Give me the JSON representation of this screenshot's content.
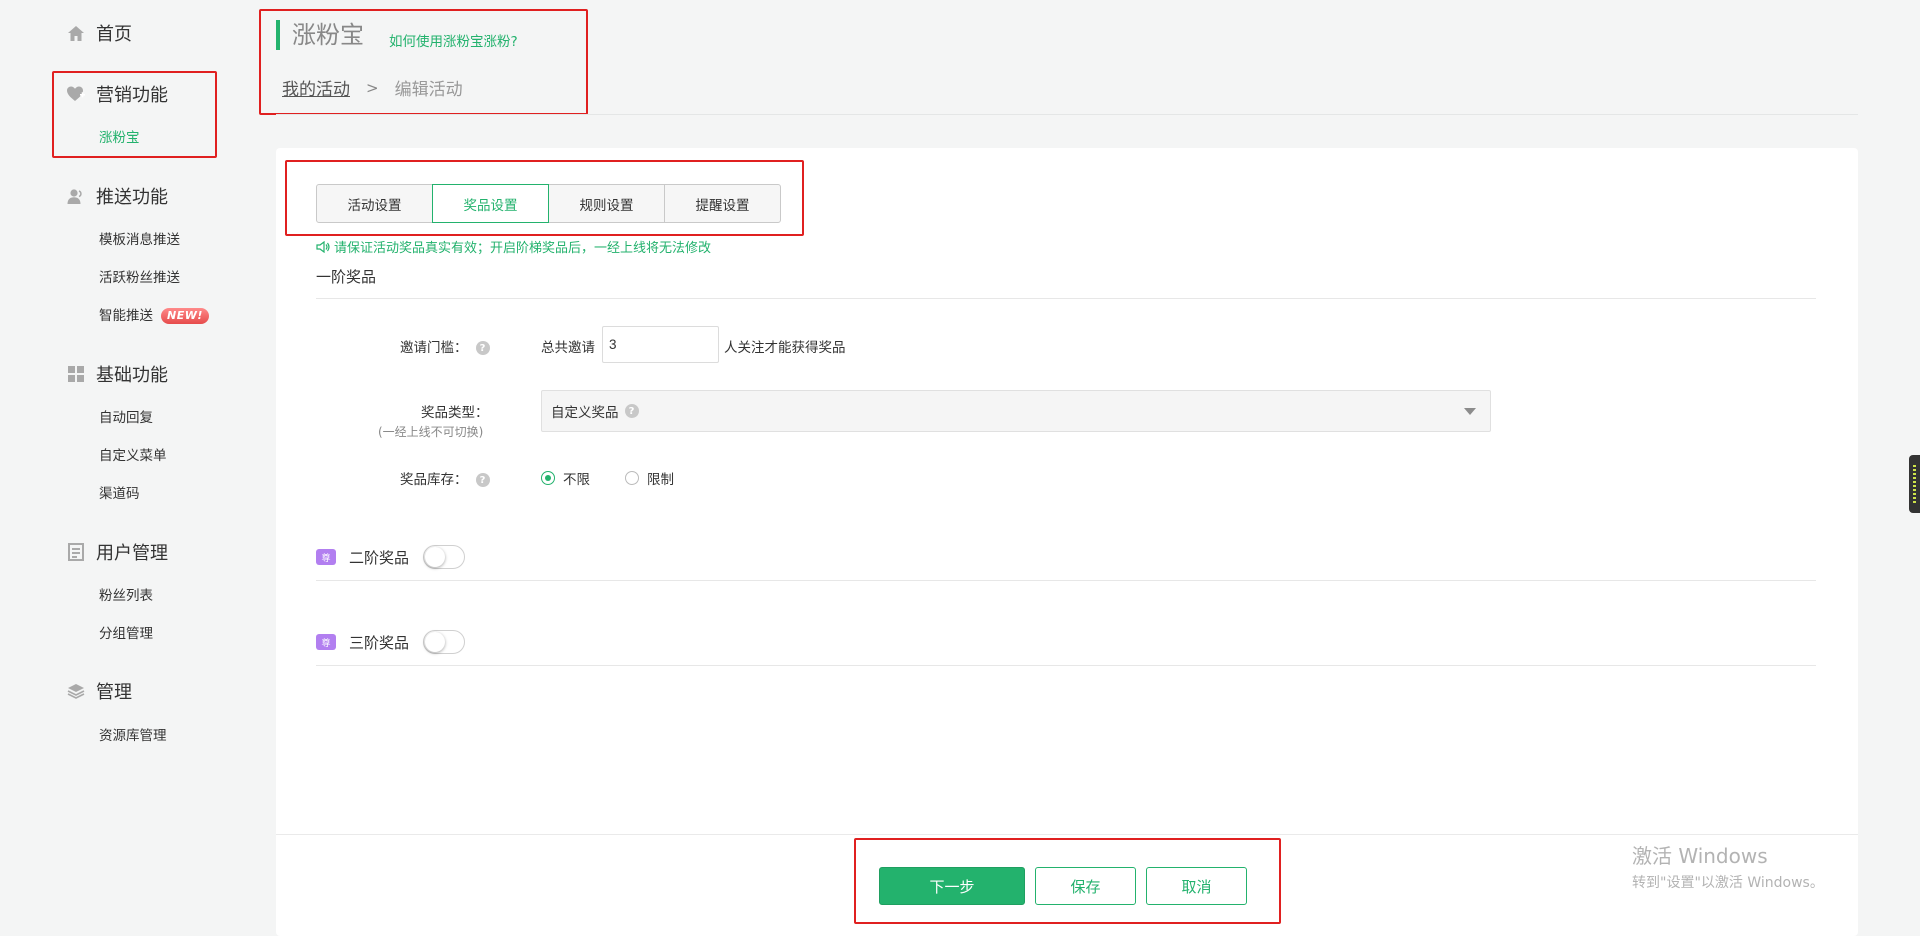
{
  "sidebar": {
    "home": "首页",
    "marketing": {
      "title": "营销功能",
      "items": [
        "涨粉宝"
      ]
    },
    "push": {
      "title": "推送功能",
      "items": [
        "模板消息推送",
        "活跃粉丝推送",
        "智能推送"
      ],
      "new_badge": "NEW!"
    },
    "basic": {
      "title": "基础功能",
      "items": [
        "自动回复",
        "自定义菜单",
        "渠道码"
      ]
    },
    "users": {
      "title": "用户管理",
      "items": [
        "粉丝列表",
        "分组管理"
      ]
    },
    "manage": {
      "title": "管理",
      "items": [
        "资源库管理"
      ]
    }
  },
  "header": {
    "title": "涨粉宝",
    "help_link": "如何使用涨粉宝涨粉?",
    "breadcrumb": {
      "parent": "我的活动",
      "separator": ">",
      "current": "编辑活动"
    }
  },
  "tabs": [
    "活动设置",
    "奖品设置",
    "规则设置",
    "提醒设置"
  ],
  "active_tab": "奖品设置",
  "notice": "请保证活动奖品真实有效；开启阶梯奖品后，一经上线将无法修改",
  "tier1": {
    "title": "一阶奖品",
    "invite": {
      "label": "邀请门槛：",
      "prefix": "总共邀请",
      "value": "3",
      "suffix": "人关注才能获得奖品"
    },
    "type": {
      "label": "奖品类型：",
      "note": "(一经上线不可切换)",
      "selected": "自定义奖品"
    },
    "stock": {
      "label": "奖品库存：",
      "options": [
        "不限",
        "限制"
      ],
      "selected": "不限"
    }
  },
  "tier2": {
    "label": "二阶奖品",
    "badge": "尊",
    "enabled": false
  },
  "tier3": {
    "label": "三阶奖品",
    "badge": "尊",
    "enabled": false
  },
  "buttons": {
    "next": "下一步",
    "save": "保存",
    "cancel": "取消"
  },
  "watermark": {
    "line1": "激活 Windows",
    "line2": "转到\"设置\"以激活 Windows。"
  },
  "colors": {
    "accent": "#23b26d",
    "highlight": "#e02020",
    "badge": "#b27ff0"
  }
}
